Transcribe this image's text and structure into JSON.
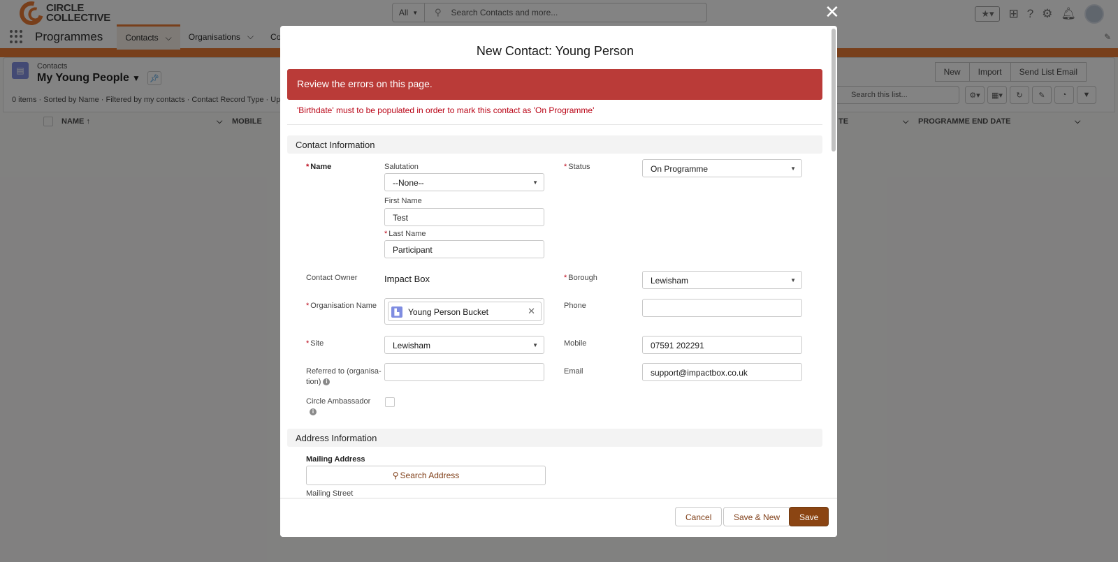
{
  "app": {
    "brand": "CIRCLE\nCOLLECTIVE",
    "name": "Programmes",
    "search_scope": "All",
    "search_placeholder": "Search Contacts and more...",
    "tabs": [
      {
        "label": "Contacts"
      },
      {
        "label": "Organisations"
      },
      {
        "label": "Contra"
      }
    ]
  },
  "list": {
    "object_label": "Contacts",
    "title": "My Young People",
    "meta": "0 items · Sorted by Name · Filtered by my contacts · Contact Record Type · Updated",
    "buttons": [
      "New",
      "Import",
      "Send List Email"
    ],
    "search_placeholder": "Search this list...",
    "columns": [
      "NAME ↑",
      "MOBILE",
      "TE",
      "PROGRAMME END DATE"
    ]
  },
  "modal": {
    "title": "New Contact: Young Person",
    "error_banner": "Review the errors on this page.",
    "error_message": "'Birthdate' must to be populated in order to mark this contact as 'On Programme'",
    "sections": {
      "contact": "Contact Information",
      "address": "Address Information"
    },
    "fields": {
      "name_label": "Name",
      "salutation_label": "Salutation",
      "salutation_value": "--None--",
      "first_name_label": "First Name",
      "first_name_value": "Test",
      "last_name_label": "Last Name",
      "last_name_value": "Participant",
      "status_label": "Status",
      "status_value": "On Programme",
      "owner_label": "Contact Owner",
      "owner_value": "Impact Box",
      "borough_label": "Borough",
      "borough_value": "Lewisham",
      "org_label": "Organisation Name",
      "org_value": "Young Person Bucket",
      "phone_label": "Phone",
      "phone_value": "",
      "site_label": "Site",
      "site_value": "Lewisham",
      "mobile_label": "Mobile",
      "mobile_value": "07591 202291",
      "referred_label_1": "Referred to (organisa-",
      "referred_label_2": "tion)",
      "referred_value": "",
      "email_label": "Email",
      "email_value": "support@impactbox.co.uk",
      "ambassador_label": "Circle Ambassador",
      "mailing_address_label": "Mailing Address",
      "search_address_label": "Search Address",
      "mailing_street_label": "Mailing Street"
    },
    "footer": {
      "cancel": "Cancel",
      "save_new": "Save & New",
      "save": "Save"
    }
  },
  "colors": {
    "accent": "#e8772e",
    "error": "#ba3b38",
    "primary_button": "#8b4513"
  }
}
